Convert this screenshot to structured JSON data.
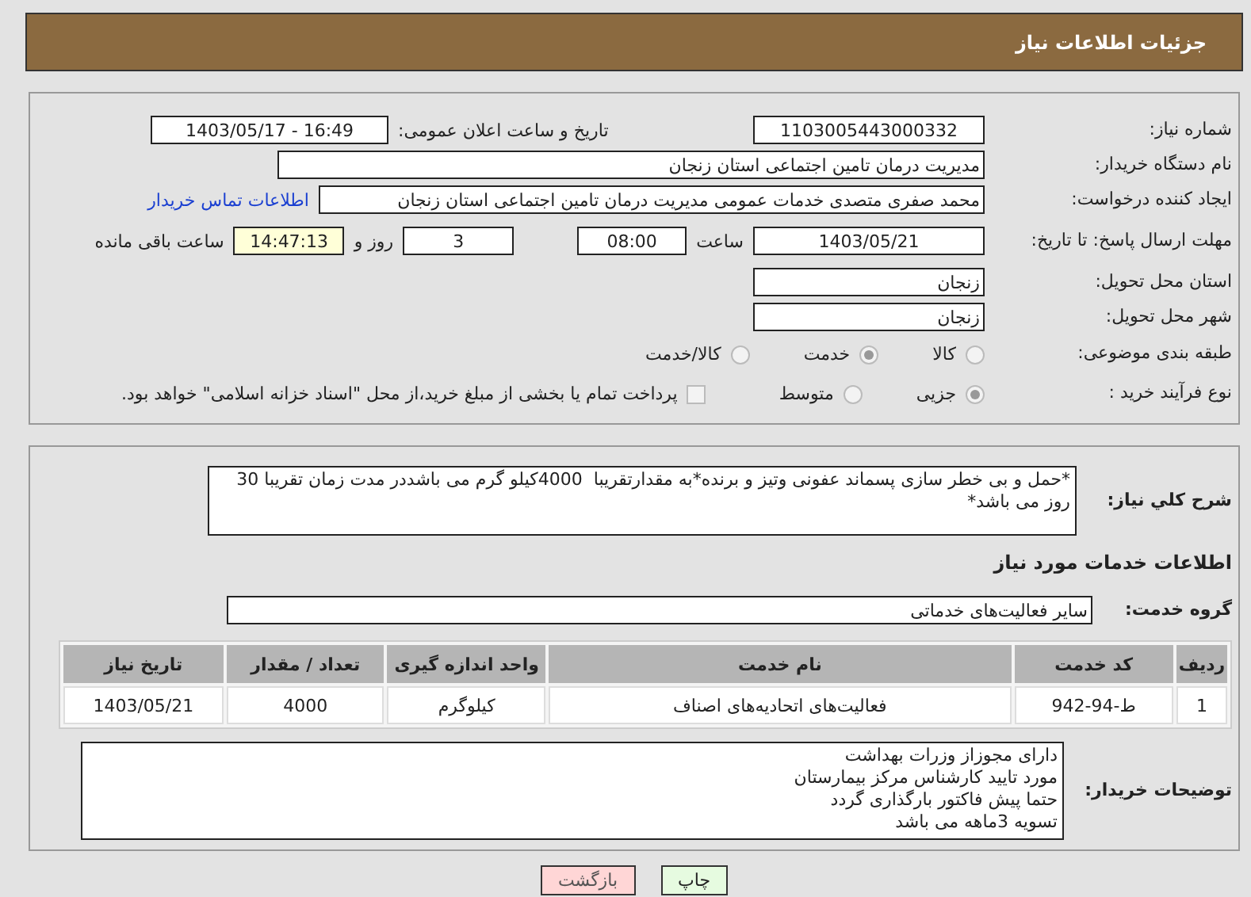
{
  "header": {
    "title": "جزئیات اطلاعات نیاز"
  },
  "details": {
    "need_number": {
      "label": "شماره نیاز:",
      "value": "1103005443000332"
    },
    "announce": {
      "label": "تاریخ و ساعت اعلان عمومی:",
      "value": "1403/05/17 - 16:49"
    },
    "buyer": {
      "label": "نام دستگاه خریدار:",
      "value": "مدیریت درمان تامین اجتماعی استان زنجان"
    },
    "creator": {
      "label": "ایجاد کننده درخواست:",
      "value": "محمد صفری متصدی خدمات عمومی مدیریت درمان تامین اجتماعی استان زنجان",
      "link": "اطلاعات تماس خریدار"
    },
    "deadline": {
      "label": "مهلت ارسال پاسخ: تا تاریخ:",
      "date": "1403/05/21",
      "time_label": "ساعت",
      "time": "08:00",
      "days": "3",
      "days_label": "روز و",
      "remaining": "14:47:13",
      "remaining_label": "ساعت باقی مانده"
    },
    "province": {
      "label": "استان محل تحویل:",
      "value": "زنجان"
    },
    "city": {
      "label": "شهر محل تحویل:",
      "value": "زنجان"
    },
    "category": {
      "label": "طبقه بندی موضوعی:",
      "options": [
        {
          "label": "کالا",
          "selected": false
        },
        {
          "label": "خدمت",
          "selected": true
        },
        {
          "label": "کالا/خدمت",
          "selected": false
        }
      ]
    },
    "process": {
      "label": "نوع فرآیند خرید :",
      "options": [
        {
          "label": "جزیی",
          "selected": true
        },
        {
          "label": "متوسط",
          "selected": false
        }
      ],
      "payment": {
        "label": "پرداخت تمام یا بخشی از مبلغ خرید،از محل \"اسناد خزانه اسلامی\" خواهد بود.",
        "checked": false
      }
    }
  },
  "summary": {
    "label": "شرح کلي نياز:",
    "value": "*حمل و بی خطر سازی پسماند عفونی وتیز و برنده*به مقدارتقریبا  4000کیلو گرم می باشددر مدت زمان تقریبا 30 روز می باشد*"
  },
  "services": {
    "title": "اطلاعات خدمات مورد نیاز",
    "group_label": "گروه خدمت:",
    "group": "سایر فعالیت‌های خدماتی",
    "table": {
      "columns": [
        "ردیف",
        "کد خدمت",
        "نام خدمت",
        "واحد اندازه گیری",
        "تعداد / مقدار",
        "تاریخ نیاز"
      ],
      "rows": [
        [
          "1",
          "ط-94-942",
          "فعالیت‌های اتحادیه‌های اصناف",
          "کیلوگرم",
          "4000",
          "1403/05/21"
        ]
      ]
    }
  },
  "notes": {
    "label": "توضیحات خریدار:",
    "value": "دارای مجوزاز وزرات بهداشت\nمورد تایید کارشناس مرکز بیمارستان\nحتما پیش فاکتور بارگذاری گردد\nتسویه 3ماهه می باشد"
  },
  "buttons": [
    {
      "kind": "print",
      "label": "چاپ"
    },
    {
      "kind": "back",
      "label": "بازگشت"
    }
  ]
}
